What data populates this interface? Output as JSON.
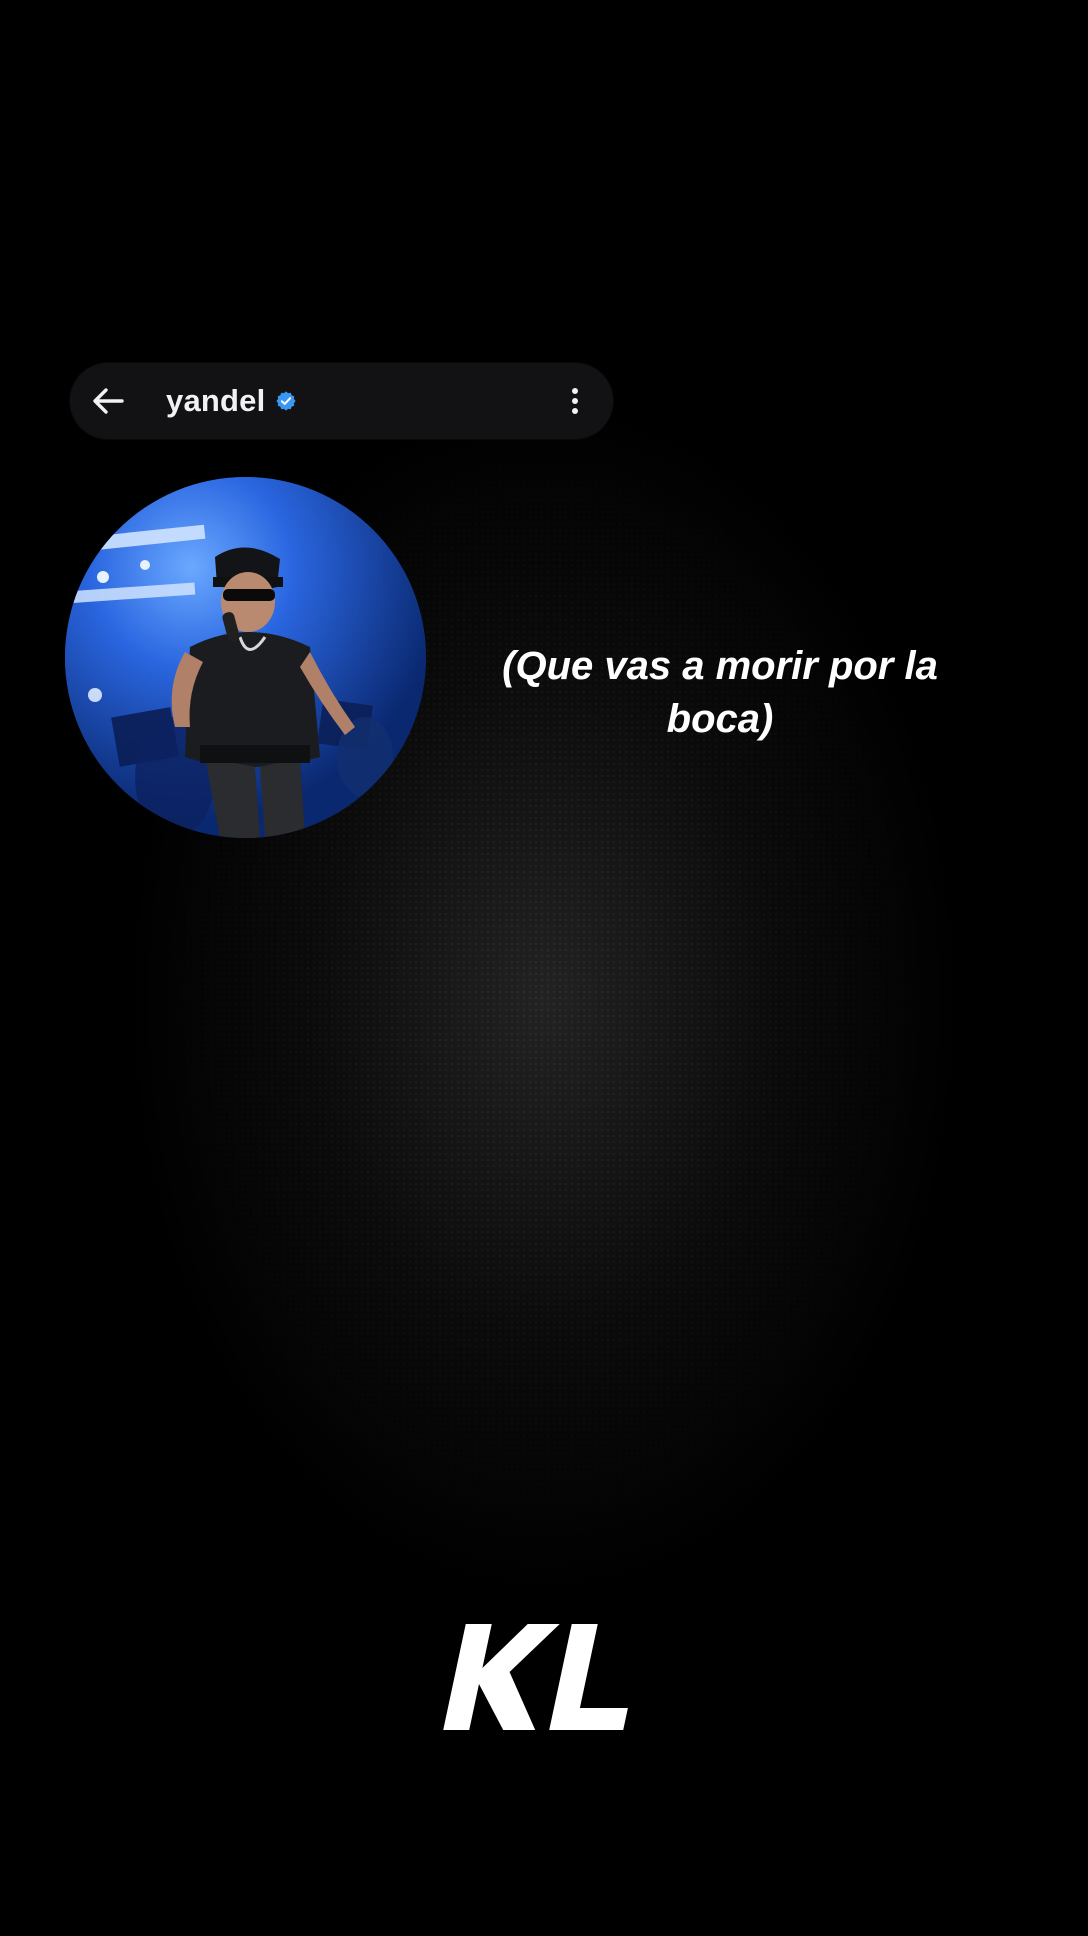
{
  "header": {
    "username": "yandel",
    "verified": true,
    "back_icon": "arrow-left-icon",
    "more_icon": "more-vertical-icon",
    "verified_color": "#3897f0"
  },
  "avatar": {
    "description_icon": "profile-photo"
  },
  "lyric": {
    "text": "(Que vas a morir por la boca)"
  },
  "watermark": {
    "text": "KL"
  },
  "colors": {
    "background": "#000000",
    "header_bg": "#121214",
    "text": "#ffffff"
  }
}
